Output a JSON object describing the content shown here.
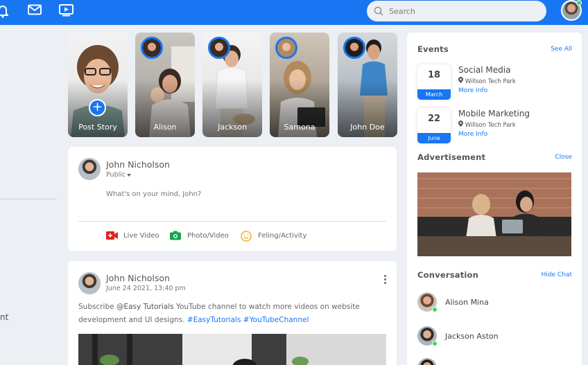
{
  "topbar": {
    "search_placeholder": "Search",
    "icons": [
      "bell-icon",
      "mail-icon",
      "video-icon",
      "search-icon"
    ],
    "accent": "#1876f2"
  },
  "left": {
    "partial_text": "nt"
  },
  "stories": [
    {
      "label": "Post Story"
    },
    {
      "label": "Alison"
    },
    {
      "label": "Jackson"
    },
    {
      "label": "Samona"
    },
    {
      "label": "John Doe"
    }
  ],
  "composer": {
    "user": "John Nicholson",
    "privacy": "Public",
    "placeholder": "What's on your mind, John?",
    "actions": [
      {
        "label": "Live Video",
        "icon": "live-video-icon"
      },
      {
        "label": "Photo/Video",
        "icon": "camera-icon"
      },
      {
        "label": "Feling/Activity",
        "icon": "smile-icon"
      }
    ]
  },
  "post": {
    "user": "John Nicholson",
    "time": "June 24 2021, 13:40 pm",
    "text_before": "Subscribe ",
    "mention": "@Easy Tutorials",
    "text_after": " YouTube channel to watch more videos on website development and UI designs. ",
    "tag1": "#EasyTutorials",
    "tag2": "#YouTubeChannel"
  },
  "sidebar": {
    "events_title": "Events",
    "see_all": "See All",
    "events": [
      {
        "day": "18",
        "month": "March",
        "title": "Social Media",
        "place": "Willson Tech Park",
        "more": "More Info"
      },
      {
        "day": "22",
        "month": "June",
        "title": "Mobile Marketing",
        "place": "Willson Tech Park",
        "more": "More Info"
      }
    ],
    "ad_title": "Advertisement",
    "ad_close": "Close",
    "conv_title": "Conversation",
    "hide_chat": "Hide Chat",
    "contacts": [
      {
        "name": "Alison Mina"
      },
      {
        "name": "Jackson Aston"
      }
    ],
    "online_color": "#41db51"
  }
}
